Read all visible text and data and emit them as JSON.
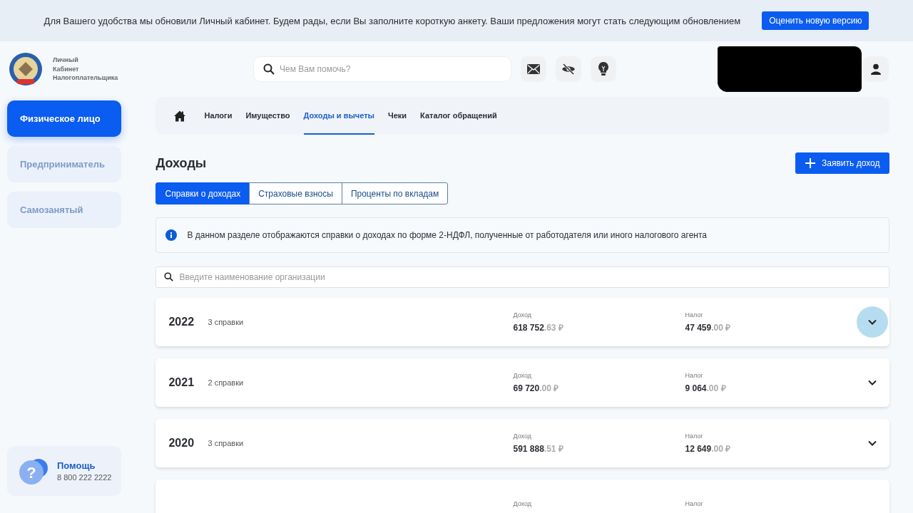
{
  "banner": {
    "text": "Для Вашего удобства мы обновили Личный кабинет. Будем рады, если Вы заполните короткую анкету. Ваши предложения могут стать следующим обновлением",
    "button": "Оценить новую версию"
  },
  "logo": {
    "lines": [
      "Личный",
      "Кабинет",
      "Налогоплательщика"
    ]
  },
  "search": {
    "placeholder": "Чем Вам помочь?"
  },
  "sidebar": {
    "items": [
      {
        "label": "Физическое лицо",
        "selected": true
      },
      {
        "label": "Предприниматель",
        "selected": false
      },
      {
        "label": "Самозанятый",
        "selected": false
      }
    ],
    "help": {
      "icon": "?",
      "title": "Помощь",
      "phone": "8 800 222 2222"
    }
  },
  "nav": {
    "items": [
      {
        "label": "Налоги",
        "selected": false
      },
      {
        "label": "Имущество",
        "selected": false
      },
      {
        "label": "Доходы и вычеты",
        "selected": true
      },
      {
        "label": "Чеки",
        "selected": false
      },
      {
        "label": "Каталог обращений",
        "selected": false
      }
    ]
  },
  "page": {
    "title": "Доходы",
    "action": "Заявить доход"
  },
  "tabs": [
    {
      "label": "Справки о доходах",
      "selected": true
    },
    {
      "label": "Страховые взносы",
      "selected": false
    },
    {
      "label": "Проценты по вкладам",
      "selected": false
    }
  ],
  "info": "В данном разделе отображаются справки о доходах по форме 2-НДФЛ, полученные от работодателя или иного налогового агента",
  "org_search": {
    "placeholder": "Введите наименование организации"
  },
  "years": [
    {
      "year": "2022",
      "count": "3 справки",
      "income_label": "Доход",
      "income": "618 752",
      "income_fraction": ".63 ₽",
      "tax_label": "Налог",
      "tax": "47 459",
      "tax_fraction": ".00 ₽",
      "hovered": true
    },
    {
      "year": "2021",
      "count": "2 справки",
      "income_label": "Доход",
      "income": "69 720",
      "income_fraction": ".00 ₽",
      "tax_label": "Налог",
      "tax": "9 064",
      "tax_fraction": ".00 ₽",
      "hovered": false
    },
    {
      "year": "2020",
      "count": "3 справки",
      "income_label": "Доход",
      "income": "591 888",
      "income_fraction": ".51 ₽",
      "tax_label": "Налог",
      "tax": "12 649",
      "tax_fraction": ".00 ₽",
      "hovered": false
    },
    {
      "income_label": "Доход",
      "tax_label": "Налог",
      "hovered": false
    }
  ]
}
